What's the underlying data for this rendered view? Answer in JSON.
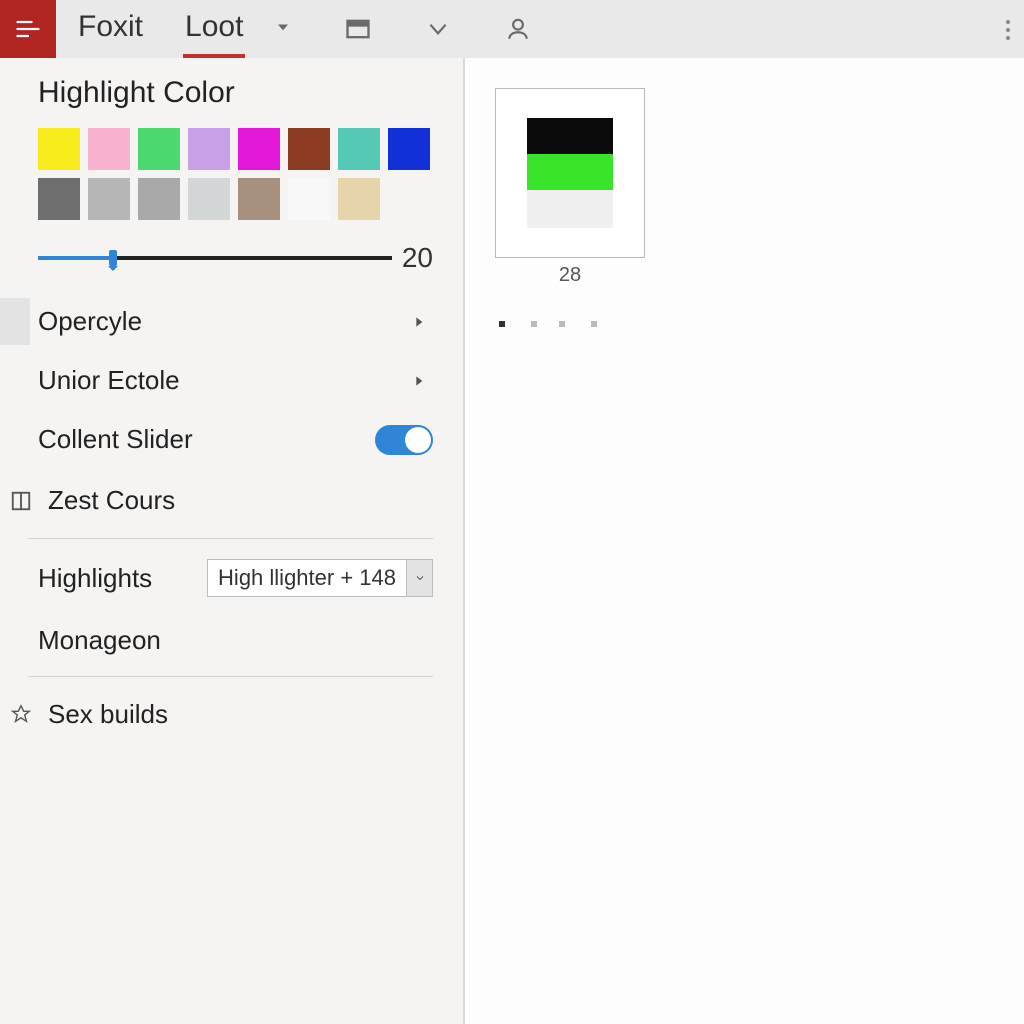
{
  "toolbar": {
    "tabs": [
      "Foxit",
      "Loot"
    ],
    "active_tab_index": 1
  },
  "panel": {
    "highlight_title": "Highlight Color",
    "swatches_row1": [
      "#f8ea1b",
      "#f8b1cf",
      "#4bd96f",
      "#c8a0e8",
      "#e418d8",
      "#8b3b22",
      "#55c9b6",
      "#1230d8"
    ],
    "swatches_row2": [
      "#6e6e6e",
      "#b6b6b6",
      "#a9a9a9",
      "#d4d7d8",
      "#a8907f",
      "#f8f8f8",
      "#e6d4ab",
      "#f5f4f3"
    ],
    "slider_value": 20,
    "slider_percent": 20,
    "rows": {
      "opercyle": "Opercyle",
      "unior_ectole": "Unior Ectole",
      "collent_slider": "Collent Slider",
      "collent_slider_on": true
    },
    "zest_label": "Zest Cours",
    "highlights_label": "Highlights",
    "highlights_value": "High llighter + 148",
    "monageon_label": "Monageon",
    "sex_builds_label": "Sex builds"
  },
  "content": {
    "thumb_label": "28",
    "dot_count": 4,
    "active_dot": 0
  }
}
